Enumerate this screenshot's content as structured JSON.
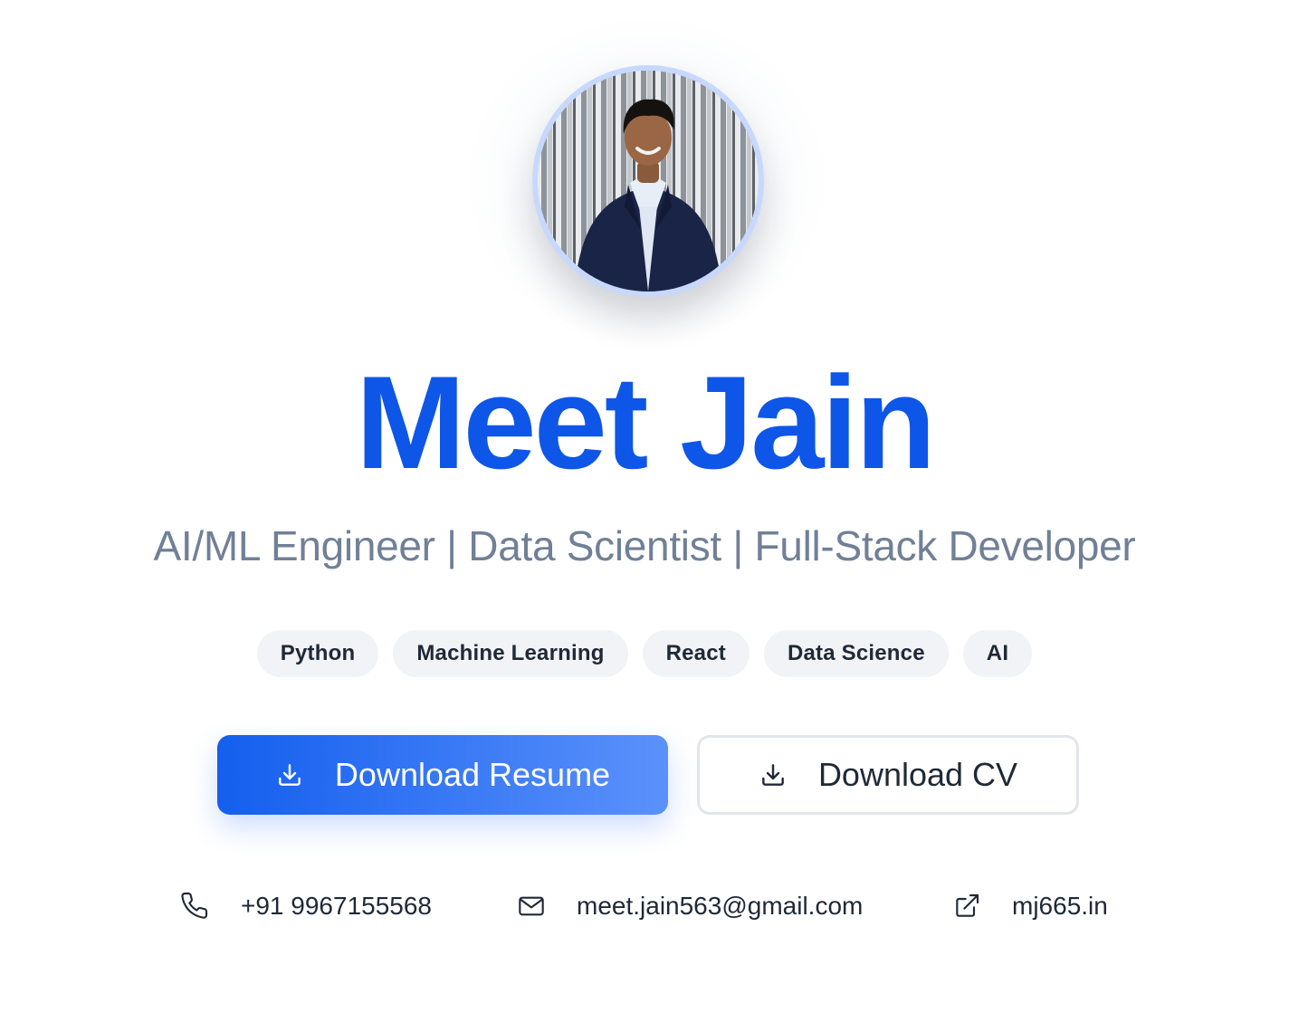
{
  "profile": {
    "name": "Meet Jain",
    "tagline": "AI/ML Engineer | Data Scientist | Full-Stack Developer",
    "avatar_icon": "profile-photo"
  },
  "skills": [
    "Python",
    "Machine Learning",
    "React",
    "Data Science",
    "AI"
  ],
  "actions": {
    "primary_label": "Download Resume",
    "secondary_label": "Download CV",
    "icon": "download-icon"
  },
  "contact": {
    "phone": "+91 9967155568",
    "email": "meet.jain563@gmail.com",
    "website": "mj665.in",
    "icons": [
      "phone-icon",
      "mail-icon",
      "external-link-icon"
    ]
  },
  "colors": {
    "accent": "#0e56e8",
    "tagline": "#718096",
    "chip_bg": "#f1f3f6",
    "avatar_ring": "#c7d8fd"
  }
}
